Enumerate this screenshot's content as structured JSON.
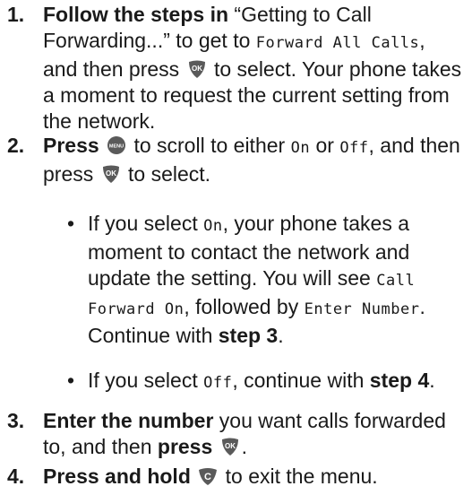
{
  "steps": [
    {
      "num": "1.",
      "parts": {
        "a_bold": "Follow the steps in",
        "b": " “Getting to Call Forwarding...” to get to ",
        "c_lcd": "Forward All Calls",
        "d": ", and then press ",
        "e": " to select. Your phone takes a moment to request the current setting from the network."
      }
    },
    {
      "num": "2.",
      "parts": {
        "a_bold": "Press",
        "b": " to scroll to either ",
        "c_lcd": "On",
        "d": " or ",
        "e_lcd": "Off",
        "f": ", and then press ",
        "g": " to select."
      }
    },
    {
      "num": "3.",
      "parts": {
        "a_bold": "Enter the number",
        "b": " you want calls forwarded to, and then ",
        "c_bold": "press",
        "d": "."
      }
    },
    {
      "num": "4.",
      "parts": {
        "a_bold": "Press and hold",
        "b": " to exit the menu."
      }
    }
  ],
  "bullets": [
    {
      "dot": "•",
      "a": "If you select ",
      "b_lcd": "On",
      "c": ", your phone takes a moment to contact the network and update the setting. You will see ",
      "d_lcd": "Call Forward On",
      "e": ", followed by ",
      "f_lcd": "Enter Number",
      "g": ". Continue with ",
      "h_bold": "step 3",
      "i": "."
    },
    {
      "dot": "•",
      "a": "If you select ",
      "b_lcd": "Off",
      "c": ", continue with ",
      "d_bold": "step 4",
      "e": "."
    }
  ],
  "keys": {
    "ok_label": "OK",
    "menu_label": "MENU",
    "clear_label": "C",
    "key_color": "#5a5a5a"
  }
}
